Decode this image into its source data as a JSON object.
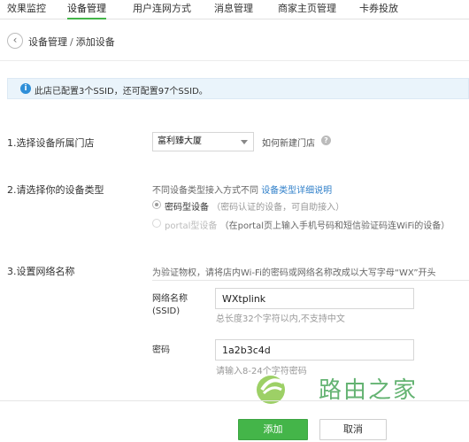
{
  "tabs": [
    {
      "label": "效果监控",
      "active": false
    },
    {
      "label": "设备管理",
      "active": true
    },
    {
      "label": "用户连网方式",
      "active": false
    },
    {
      "label": "消息管理",
      "active": false
    },
    {
      "label": "商家主页管理",
      "active": false
    },
    {
      "label": "卡券投放",
      "active": false
    }
  ],
  "header": {
    "back_icon": "back-arrow-icon",
    "breadcrumb_parent": "设备管理",
    "breadcrumb_separator": "/",
    "breadcrumb_current": "添加设备"
  },
  "info": {
    "icon": "info-icon",
    "text": "此店已配置3个SSID，还可配置97个SSID。",
    "color": "#2f8fd8"
  },
  "step1": {
    "label": "1.选择设备所属门店",
    "selected_store": "富利臻大厦",
    "how_to_link": "如何新建门店",
    "help_icon": "help-icon"
  },
  "step2": {
    "label": "2.请选择你的设备类型",
    "hint": "不同设备类型接入方式不同",
    "detail_link": "设备类型详细说明",
    "options": [
      {
        "label": "密码型设备",
        "desc": "（密码认证的设备，可自助接入）",
        "checked": true,
        "disabled": false
      },
      {
        "label": "portal型设备",
        "desc": "（在portal页上输入手机号码和短信验证码连WiFi的设备）",
        "checked": false,
        "disabled": true
      }
    ]
  },
  "step3": {
    "label": "3.设置网络名称",
    "hint": "为验证物权，请将店内Wi-Fi的密码或网络名称改成以大写字母“WX”开头",
    "ssid_label_line1": "网络名称",
    "ssid_label_line2": "(SSID)",
    "ssid_value": "WXtplink",
    "ssid_tip": "总长度32个字符以内,不支持中文",
    "password_label": "密码",
    "password_value": "1a2b3c4d",
    "password_tip": "请输入8-24个字符密码"
  },
  "footer": {
    "add_label": "添加",
    "cancel_label": "取消"
  },
  "watermark": {
    "text": "路由之家",
    "logo_icon": "router-home-logo-icon"
  },
  "colors": {
    "accent_green": "#44b549",
    "link_blue": "#2f7fc9",
    "info_bg": "#eaf4fb"
  }
}
